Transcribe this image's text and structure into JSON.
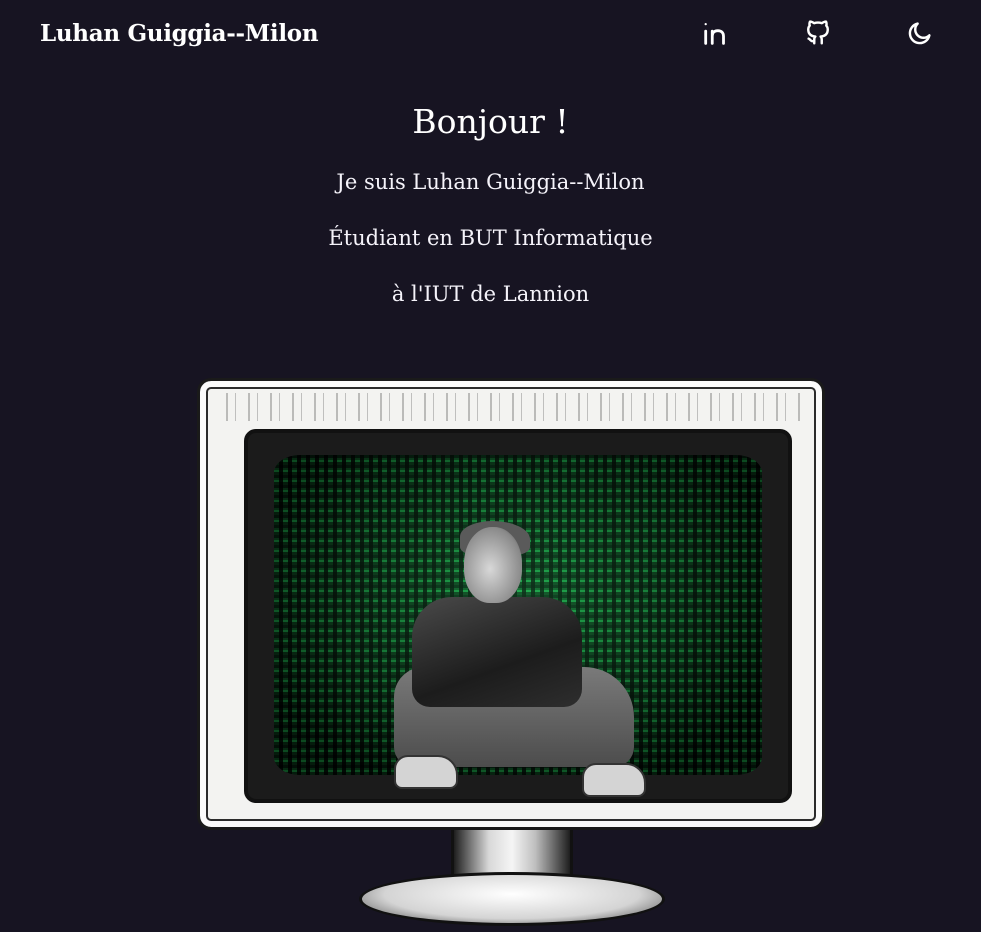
{
  "header": {
    "brand": "Luhan Guiggia--Milon",
    "icons": [
      "linkedin-icon",
      "github-icon",
      "moon-icon"
    ]
  },
  "intro": {
    "greeting": "Bonjour !",
    "lines": [
      "Je suis Luhan Guiggia--Milon",
      "Étudiant en BUT Informatique",
      "à l'IUT de Lannion"
    ]
  },
  "colors": {
    "background": "#171422",
    "text": "#ffffff",
    "matrix_green": "#1aa447"
  }
}
